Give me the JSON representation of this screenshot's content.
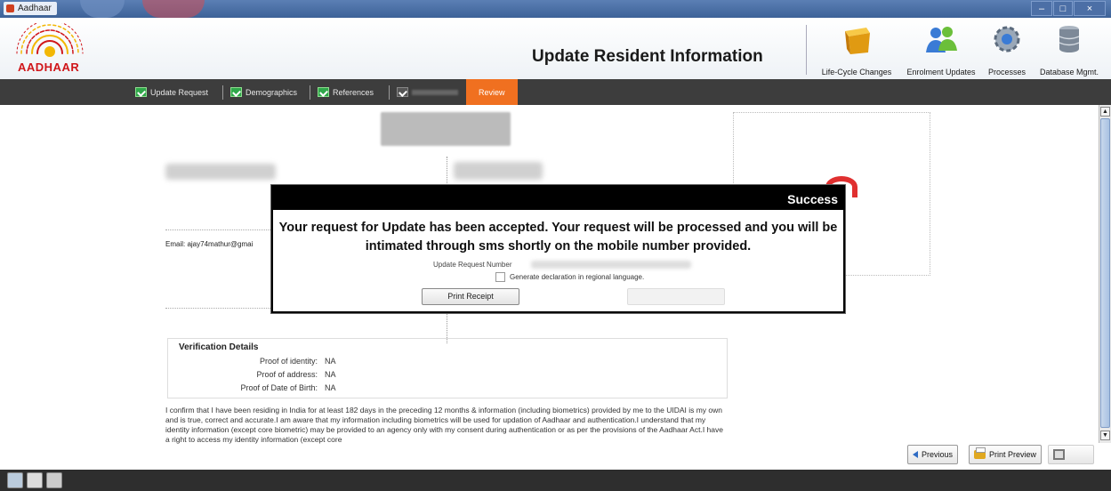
{
  "window": {
    "title": "Aadhaar"
  },
  "header": {
    "logo_text": "AADHAAR",
    "page_title": "Update Resident Information",
    "nav": [
      {
        "label": "Life-Cycle Changes",
        "icon": "box-icon"
      },
      {
        "label": "Enrolment Updates",
        "icon": "users-icon"
      },
      {
        "label": "Processes",
        "icon": "gear-icon"
      },
      {
        "label": "Database Mgmt.",
        "icon": "database-icon"
      }
    ]
  },
  "steps": [
    {
      "label": "Update Request",
      "done": true
    },
    {
      "label": "Demographics",
      "done": true
    },
    {
      "label": "References",
      "done": true
    },
    {
      "label": "Review",
      "active": true
    }
  ],
  "form": {
    "email_label": "Email: ajay74mathur@gmai"
  },
  "verification": {
    "title": "Verification Details",
    "rows": [
      {
        "label": "Proof of identity:",
        "value": "NA"
      },
      {
        "label": "Proof of address:",
        "value": "NA"
      },
      {
        "label": "Proof of Date of Birth:",
        "value": "NA"
      }
    ]
  },
  "declaration": "I confirm that I have been residing in India for at least 182 days in the preceding 12 months & information (including biometrics) provided by me to the UIDAI is my own and is true, correct and accurate.I am aware that my information including biometrics will be used for updation of Aadhaar and authentication.I understand that my identity information (except core biometric) may be provided to an agency only with my consent during authentication or as per the provisions of the Aadhaar Act.I have a right to access my identity information (except core",
  "modal": {
    "title": "Success",
    "message": "Your request for Update has been accepted. Your request will be processed and you will be intimated through sms shortly on the mobile number provided.",
    "request_number_label": "Update Request Number",
    "checkbox_label": "Generate declaration in regional language.",
    "print_receipt_label": "Print Receipt"
  },
  "bottom_nav": {
    "previous_label": "Previous",
    "print_preview_label": "Print Preview"
  },
  "colors": {
    "review_tab": "#f07020",
    "step_check": "#2fa84a",
    "logo_red": "#d0161a"
  }
}
